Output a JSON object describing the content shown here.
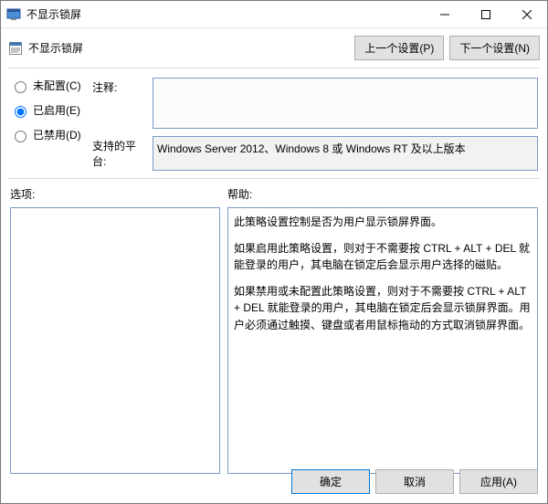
{
  "window": {
    "title": "不显示锁屏"
  },
  "header": {
    "policy_name": "不显示锁屏",
    "prev_setting": "上一个设置(P)",
    "next_setting": "下一个设置(N)"
  },
  "state": {
    "not_configured": "未配置(C)",
    "enabled": "已启用(E)",
    "disabled": "已禁用(D)"
  },
  "labels": {
    "comment": "注释:",
    "supported": "支持的平台:",
    "options": "选项:",
    "help": "帮助:"
  },
  "fields": {
    "comment_value": "",
    "supported_value": "Windows Server 2012、Windows 8 或 Windows RT 及以上版本"
  },
  "help": {
    "p1": "此策略设置控制是否为用户显示锁屏界面。",
    "p2": "如果启用此策略设置，则对于不需要按 CTRL + ALT + DEL  就能登录的用户，其电脑在锁定后会显示用户选择的磁贴。",
    "p3": "如果禁用或未配置此策略设置，则对于不需要按 CTRL + ALT + DEL 就能登录的用户，其电脑在锁定后会显示锁屏界面。用户必须通过触摸、键盘或者用鼠标拖动的方式取消锁屏界面。"
  },
  "buttons": {
    "ok": "确定",
    "cancel": "取消",
    "apply": "应用(A)"
  }
}
